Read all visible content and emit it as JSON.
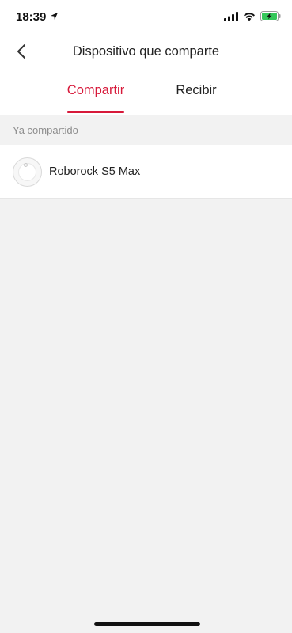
{
  "status_bar": {
    "time": "18:39",
    "icons": [
      "location-arrow-icon",
      "cellular-signal-icon",
      "wifi-icon",
      "battery-charging-icon"
    ]
  },
  "header": {
    "title": "Dispositivo que comparte",
    "back_icon": "chevron-left-icon"
  },
  "tabs": [
    {
      "label": "Compartir",
      "active": true
    },
    {
      "label": "Recibir",
      "active": false
    }
  ],
  "colors": {
    "accent": "#d7193a",
    "background": "#f2f2f2",
    "surface": "#ffffff",
    "battery": "#34c759"
  },
  "section": {
    "label": "Ya compartido"
  },
  "devices": [
    {
      "name": "Roborock S5 Max",
      "icon": "robot-vacuum-icon"
    }
  ]
}
